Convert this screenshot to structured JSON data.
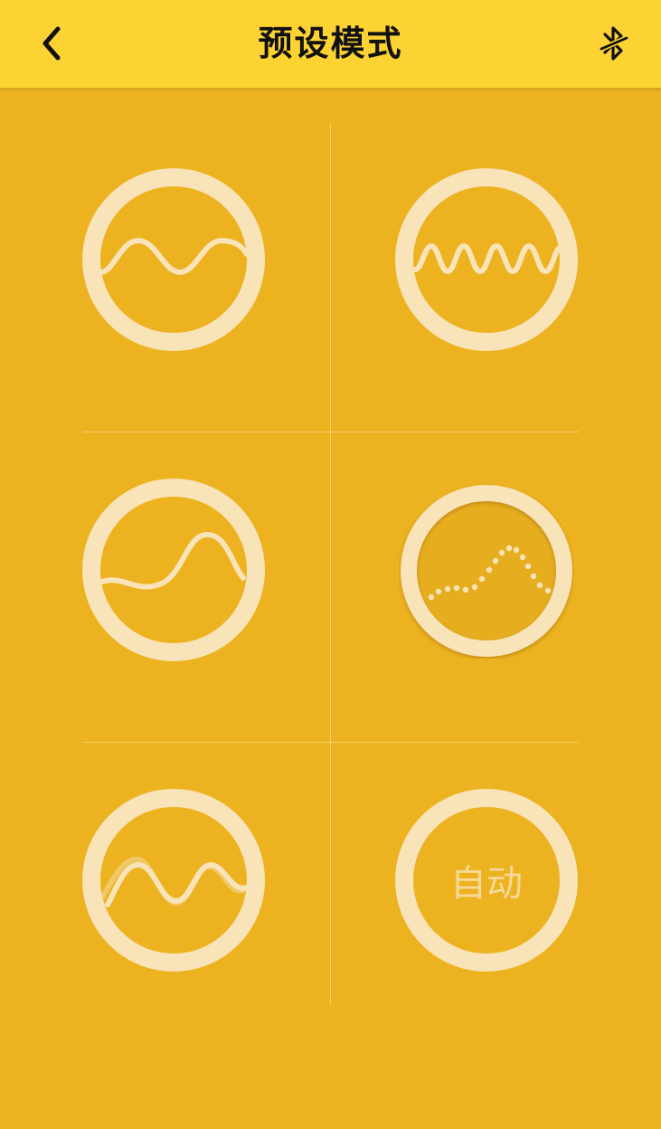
{
  "header": {
    "title": "预设模式",
    "back_icon": "chevron-left-icon",
    "bluetooth_icon": "bluetooth-disconnected-icon",
    "background_color": "#FDD333"
  },
  "theme": {
    "background": "#ECB220",
    "ring_color": "#F9E3B8"
  },
  "modes": [
    {
      "id": "sine-wave",
      "icon": "sine-wave-icon",
      "selected": false
    },
    {
      "id": "fast-wave",
      "icon": "fast-wave-icon",
      "selected": false
    },
    {
      "id": "rising-wave",
      "icon": "rising-wave-icon",
      "selected": false
    },
    {
      "id": "dotted-wave",
      "icon": "dotted-wave-icon",
      "selected": true
    },
    {
      "id": "double-wave",
      "icon": "double-wave-icon",
      "selected": false
    },
    {
      "id": "auto",
      "icon": "",
      "label": "自动",
      "selected": false
    }
  ]
}
